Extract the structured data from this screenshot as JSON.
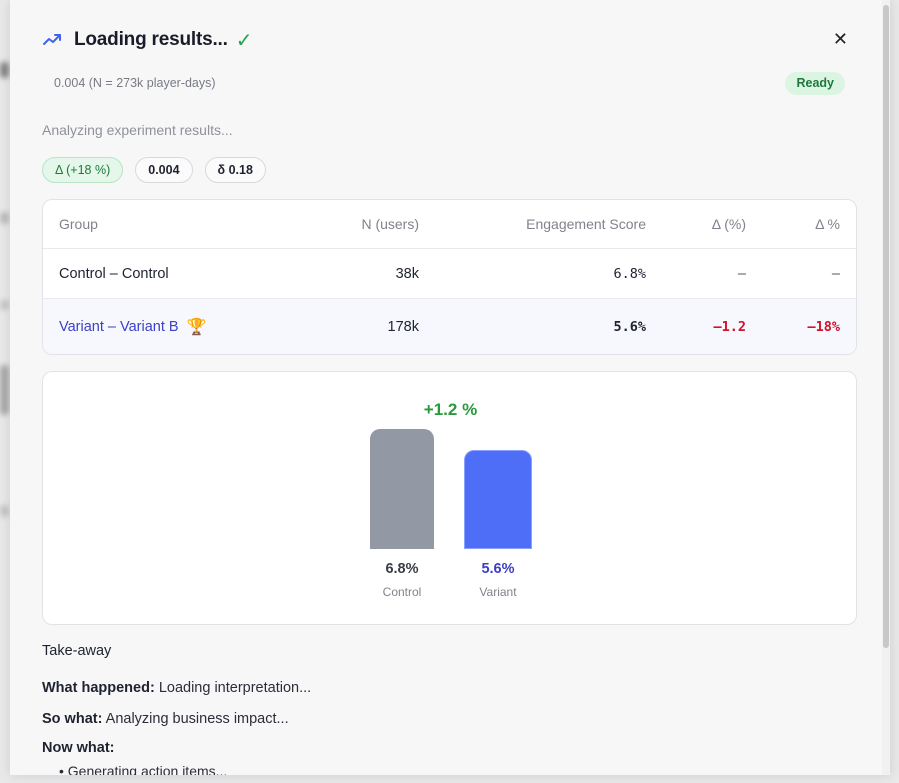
{
  "page": {
    "close_icon": "x-icon"
  },
  "modal": {
    "title": "Loading results...",
    "title_icon": "trend-up-icon",
    "status_icon": "check-icon",
    "close_icon": "x-icon",
    "meta": "0.004 (N = 273k player-days)",
    "status_badge": "Ready",
    "subtitle": "Analyzing experiment results...",
    "chips": [
      "Δ (+18 %)",
      "0.004",
      "δ 0.18"
    ]
  },
  "table": {
    "headers": [
      "Group",
      "N (users)",
      "Engagement Score",
      "Δ (%)",
      "Δ %"
    ],
    "rows": [
      {
        "group": "Control – Control",
        "n": "38k",
        "score": "6.8%",
        "delta": "–",
        "delta_pct": "–"
      },
      {
        "group": "Variant – Variant B",
        "n": "178k",
        "score": "5.6%",
        "delta": "–1.2",
        "delta_pct": "–18%",
        "winner_icon": "trophy-icon"
      }
    ]
  },
  "chart_data": {
    "type": "bar",
    "title": "+1.2 %",
    "categories": [
      "Control",
      "Variant"
    ],
    "values": [
      6.8,
      5.6
    ],
    "value_labels": [
      "6.8%",
      "5.6%"
    ],
    "ylim": [
      0,
      6.8
    ],
    "colors": [
      "#9298a4",
      "#4e6ef8"
    ],
    "xlabel": "",
    "ylabel": ""
  },
  "takeaway": {
    "title": "Take-away",
    "what_happened_label": "What happened:",
    "what_happened": "Loading interpretation...",
    "so_what_label": "So what:",
    "so_what": "Analyzing business impact...",
    "now_what_label": "Now what:",
    "bullet": "• Generating action items..."
  },
  "colors": {
    "accent": "#4e6ef8",
    "positive": "#2a9a3d",
    "negative": "#d0122c",
    "variant_text": "#3b3fc7"
  }
}
